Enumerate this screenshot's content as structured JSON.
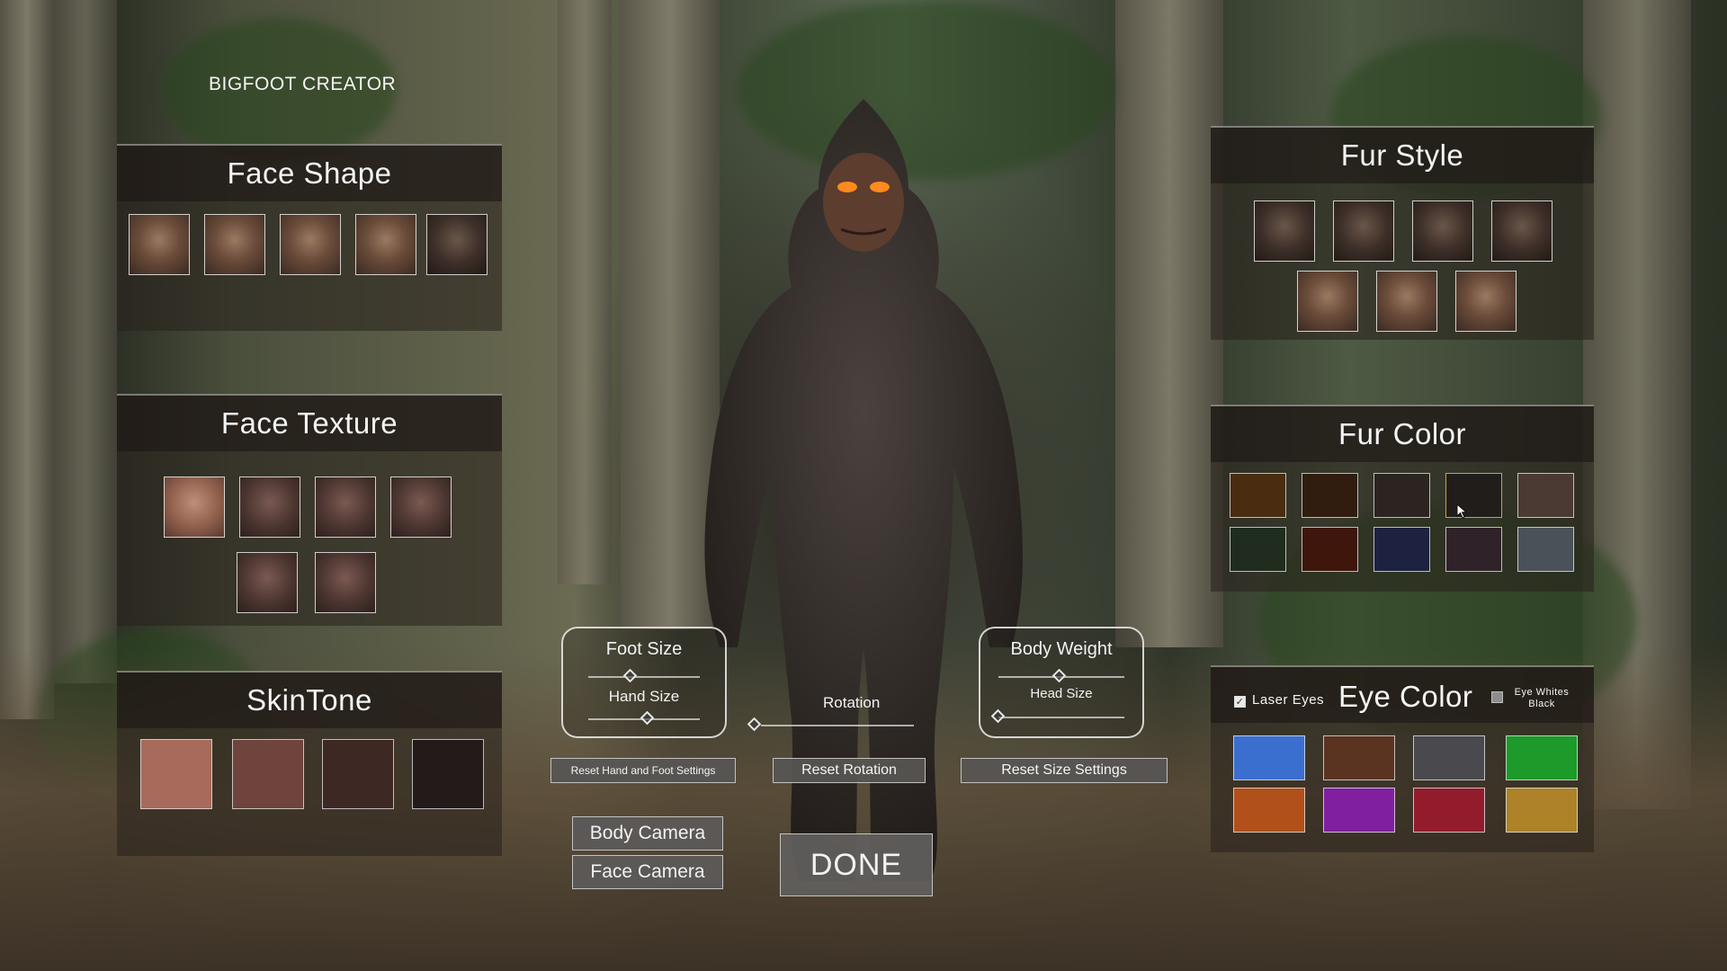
{
  "app_title": "BIGFOOT CREATOR",
  "face_shape": {
    "title": "Face Shape",
    "options": [
      "face-shape-1",
      "face-shape-2",
      "face-shape-3",
      "face-shape-4",
      "face-shape-5"
    ]
  },
  "face_texture": {
    "title": "Face Texture",
    "options": [
      "texture-1",
      "texture-2",
      "texture-3",
      "texture-4",
      "texture-5",
      "texture-6"
    ]
  },
  "skin_tone": {
    "title": "SkinTone",
    "colors": [
      "#a86a5a",
      "#6e443c",
      "#3e2824",
      "#221b1a"
    ]
  },
  "fur_style": {
    "title": "Fur Style",
    "options": [
      "style-1",
      "style-2",
      "style-3",
      "style-4",
      "style-5",
      "style-6",
      "style-7"
    ]
  },
  "fur_color": {
    "title": "Fur Color",
    "colors": [
      "#4a2c10",
      "#301d10",
      "#2b2421",
      "#211d1a",
      "#4a3a33",
      "#1f2c1e",
      "#3e160c",
      "#1d2240",
      "#2f2229",
      "#4b5158"
    ]
  },
  "eye_color": {
    "title": "Eye Color",
    "laser_eyes_label": "Laser Eyes",
    "laser_eyes_checked": true,
    "eye_whites_label_line1": "Eye Whites",
    "eye_whites_label_line2": "Black",
    "eye_whites_checked": false,
    "colors": [
      "#3b6fcf",
      "#5a3420",
      "#4a4a4e",
      "#1d9a2a",
      "#b1501a",
      "#8020a0",
      "#921c2c",
      "#ad8228"
    ]
  },
  "limb_sliders": {
    "top_label": "Foot Size",
    "bottom_label": "Hand Size"
  },
  "rotation": {
    "label": "Rotation"
  },
  "body_sliders": {
    "top_label": "Body Weight",
    "bottom_label": "Head Size"
  },
  "buttons": {
    "reset_hand_foot": "Reset Hand and Foot Settings",
    "reset_rotation": "Reset Rotation",
    "reset_size": "Reset Size Settings",
    "body_camera": "Body Camera",
    "face_camera": "Face Camera",
    "done": "DONE"
  }
}
